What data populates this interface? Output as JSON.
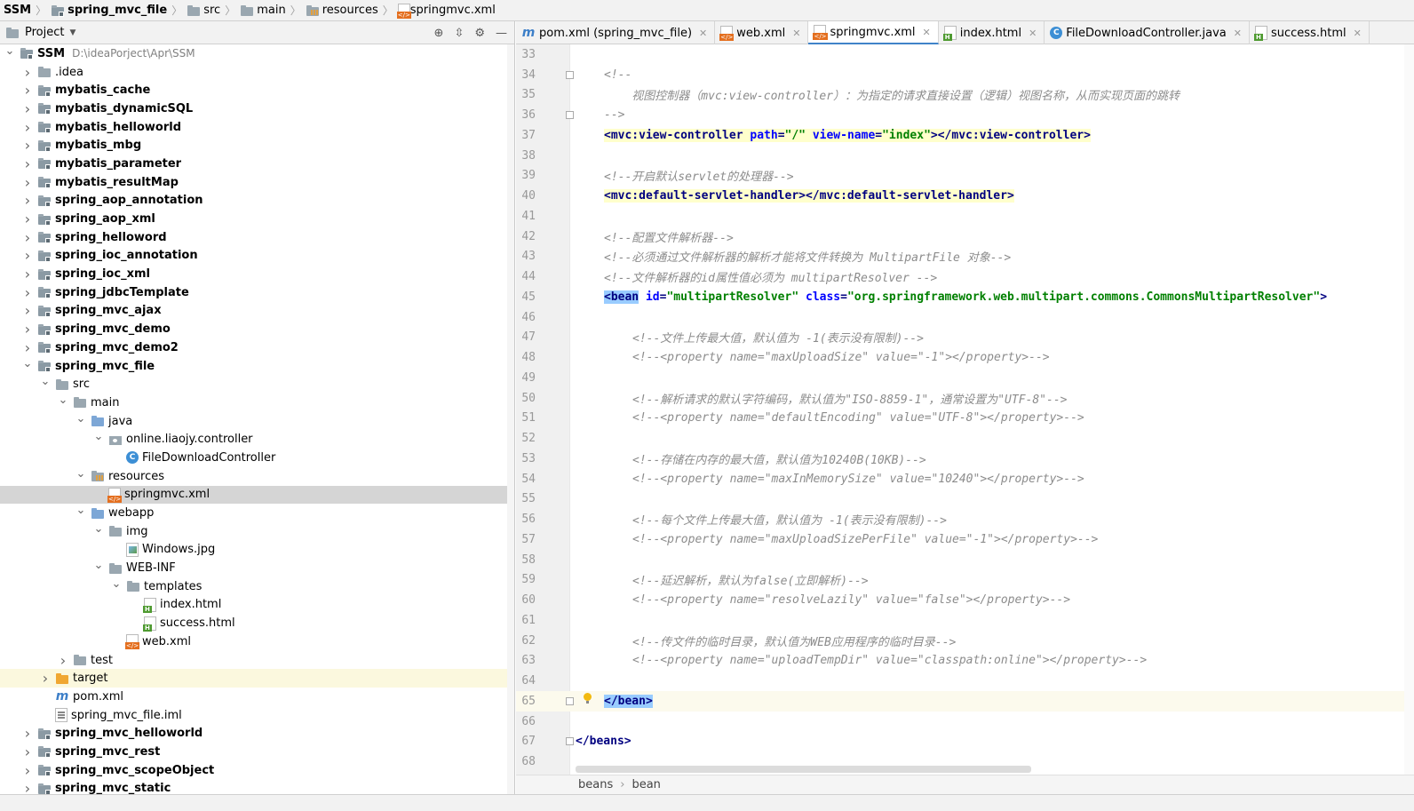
{
  "breadcrumbs": [
    "SSM",
    "spring_mvc_file",
    "src",
    "main",
    "resources",
    "springmvc.xml"
  ],
  "project_panel": {
    "title": "Project",
    "tree": [
      {
        "label": "SSM",
        "path": "D:\\ideaPorject\\Apr\\SSM",
        "depth": 0,
        "expanded": true,
        "icon": "module-folder-icon",
        "bold": true
      },
      {
        "label": ".idea",
        "depth": 1,
        "expanded": false,
        "icon": "folder-icon"
      },
      {
        "label": "mybatis_cache",
        "depth": 1,
        "expanded": false,
        "icon": "module-folder-icon",
        "bold": true
      },
      {
        "label": "mybatis_dynamicSQL",
        "depth": 1,
        "expanded": false,
        "icon": "module-folder-icon",
        "bold": true
      },
      {
        "label": "mybatis_helloworld",
        "depth": 1,
        "expanded": false,
        "icon": "module-folder-icon",
        "bold": true
      },
      {
        "label": "mybatis_mbg",
        "depth": 1,
        "expanded": false,
        "icon": "module-folder-icon",
        "bold": true
      },
      {
        "label": "mybatis_parameter",
        "depth": 1,
        "expanded": false,
        "icon": "module-folder-icon",
        "bold": true
      },
      {
        "label": "mybatis_resultMap",
        "depth": 1,
        "expanded": false,
        "icon": "module-folder-icon",
        "bold": true
      },
      {
        "label": "spring_aop_annotation",
        "depth": 1,
        "expanded": false,
        "icon": "module-folder-icon",
        "bold": true
      },
      {
        "label": "spring_aop_xml",
        "depth": 1,
        "expanded": false,
        "icon": "module-folder-icon",
        "bold": true
      },
      {
        "label": "spring_helloword",
        "depth": 1,
        "expanded": false,
        "icon": "module-folder-icon",
        "bold": true
      },
      {
        "label": "spring_ioc_annotation",
        "depth": 1,
        "expanded": false,
        "icon": "module-folder-icon",
        "bold": true
      },
      {
        "label": "spring_ioc_xml",
        "depth": 1,
        "expanded": false,
        "icon": "module-folder-icon",
        "bold": true
      },
      {
        "label": "spring_jdbcTemplate",
        "depth": 1,
        "expanded": false,
        "icon": "module-folder-icon",
        "bold": true
      },
      {
        "label": "spring_mvc_ajax",
        "depth": 1,
        "expanded": false,
        "icon": "module-folder-icon",
        "bold": true
      },
      {
        "label": "spring_mvc_demo",
        "depth": 1,
        "expanded": false,
        "icon": "module-folder-icon",
        "bold": true
      },
      {
        "label": "spring_mvc_demo2",
        "depth": 1,
        "expanded": false,
        "icon": "module-folder-icon",
        "bold": true
      },
      {
        "label": "spring_mvc_file",
        "depth": 1,
        "expanded": true,
        "icon": "module-folder-icon",
        "bold": true
      },
      {
        "label": "src",
        "depth": 2,
        "expanded": true,
        "icon": "folder-icon"
      },
      {
        "label": "main",
        "depth": 3,
        "expanded": true,
        "icon": "folder-icon"
      },
      {
        "label": "java",
        "depth": 4,
        "expanded": true,
        "icon": "source-folder-icon"
      },
      {
        "label": "online.liaojy.controller",
        "depth": 5,
        "expanded": true,
        "icon": "package-icon"
      },
      {
        "label": "FileDownloadController",
        "depth": 6,
        "leaf": true,
        "icon": "java-class-icon"
      },
      {
        "label": "resources",
        "depth": 4,
        "expanded": true,
        "icon": "resources-folder-icon"
      },
      {
        "label": "springmvc.xml",
        "depth": 5,
        "leaf": true,
        "icon": "xml-file-icon",
        "selected": true
      },
      {
        "label": "webapp",
        "depth": 4,
        "expanded": true,
        "icon": "web-folder-icon"
      },
      {
        "label": "img",
        "depth": 5,
        "expanded": true,
        "icon": "folder-icon"
      },
      {
        "label": "Windows.jpg",
        "depth": 6,
        "leaf": true,
        "icon": "image-file-icon"
      },
      {
        "label": "WEB-INF",
        "depth": 5,
        "expanded": true,
        "icon": "folder-icon"
      },
      {
        "label": "templates",
        "depth": 6,
        "expanded": true,
        "icon": "folder-icon"
      },
      {
        "label": "index.html",
        "depth": 7,
        "leaf": true,
        "icon": "html-file-icon"
      },
      {
        "label": "success.html",
        "depth": 7,
        "leaf": true,
        "icon": "html-file-icon"
      },
      {
        "label": "web.xml",
        "depth": 6,
        "leaf": true,
        "icon": "xml-file-icon"
      },
      {
        "label": "test",
        "depth": 3,
        "expanded": false,
        "icon": "folder-icon"
      },
      {
        "label": "target",
        "depth": 2,
        "expanded": false,
        "icon": "excluded-folder-icon",
        "highlighted": true
      },
      {
        "label": "pom.xml",
        "depth": 2,
        "leaf": true,
        "icon": "maven-file-icon"
      },
      {
        "label": "spring_mvc_file.iml",
        "depth": 2,
        "leaf": true,
        "icon": "iml-file-icon"
      },
      {
        "label": "spring_mvc_helloworld",
        "depth": 1,
        "expanded": false,
        "icon": "module-folder-icon",
        "bold": true
      },
      {
        "label": "spring_mvc_rest",
        "depth": 1,
        "expanded": false,
        "icon": "module-folder-icon",
        "bold": true
      },
      {
        "label": "spring_mvc_scopeObject",
        "depth": 1,
        "expanded": false,
        "icon": "module-folder-icon",
        "bold": true
      },
      {
        "label": "spring_mvc_static",
        "depth": 1,
        "expanded": false,
        "icon": "module-folder-icon",
        "bold": true
      }
    ]
  },
  "tabs": [
    {
      "label": "pom.xml (spring_mvc_file)",
      "icon": "maven-file-icon",
      "active": false
    },
    {
      "label": "web.xml",
      "icon": "xml-file-icon",
      "active": false
    },
    {
      "label": "springmvc.xml",
      "icon": "xml-file-icon",
      "active": true
    },
    {
      "label": "index.html",
      "icon": "html-file-icon",
      "active": false
    },
    {
      "label": "FileDownloadController.java",
      "icon": "java-class-icon",
      "active": false
    },
    {
      "label": "success.html",
      "icon": "html-file-icon",
      "active": false
    }
  ],
  "editor": {
    "current_line": 65,
    "lines": [
      {
        "n": "33",
        "indent": 0,
        "parts": []
      },
      {
        "n": "34",
        "indent": 1,
        "fold": true,
        "parts": [
          [
            "c",
            "<!--"
          ]
        ]
      },
      {
        "n": "35",
        "indent": 1,
        "parts": [
          [
            "c",
            "    视图控制器（mvc:view-controller）：为指定的请求直接设置（逻辑）视图名称，从而实现页面的跳转"
          ]
        ]
      },
      {
        "n": "36",
        "indent": 1,
        "fold": true,
        "parts": [
          [
            "c",
            "-->"
          ]
        ]
      },
      {
        "n": "37",
        "indent": 1,
        "hl": true,
        "parts": [
          [
            "tg",
            "<mvc:view-controller "
          ],
          [
            "at",
            "path"
          ],
          [
            "tg",
            "="
          ],
          [
            "sv",
            "\"/\""
          ],
          [
            "tg",
            " "
          ],
          [
            "at",
            "view-name"
          ],
          [
            "tg",
            "="
          ],
          [
            "sv",
            "\"index\""
          ],
          [
            "tg",
            "></mvc:view-controller>"
          ]
        ]
      },
      {
        "n": "38",
        "indent": 1,
        "parts": []
      },
      {
        "n": "39",
        "indent": 1,
        "parts": [
          [
            "c",
            "<!--开启默认servlet的处理器-->"
          ]
        ]
      },
      {
        "n": "40",
        "indent": 1,
        "hl": true,
        "parts": [
          [
            "tg",
            "<mvc:default-servlet-handler></mvc:default-servlet-handler>"
          ]
        ]
      },
      {
        "n": "41",
        "indent": 1,
        "parts": []
      },
      {
        "n": "42",
        "indent": 1,
        "parts": [
          [
            "c",
            "<!--配置文件解析器-->"
          ]
        ]
      },
      {
        "n": "43",
        "indent": 1,
        "parts": [
          [
            "c",
            "<!--必须通过文件解析器的解析才能将文件转换为 MultipartFile 对象-->"
          ]
        ]
      },
      {
        "n": "44",
        "indent": 1,
        "parts": [
          [
            "c",
            "<!--文件解析器的id属性值必须为 multipartResolver -->"
          ]
        ]
      },
      {
        "n": "45",
        "indent": 1,
        "parts": [
          [
            "bm",
            "<bean"
          ],
          [
            "tg",
            " "
          ],
          [
            "at",
            "id"
          ],
          [
            "tg",
            "="
          ],
          [
            "sv",
            "\"multipartResolver\""
          ],
          [
            "tg",
            " "
          ],
          [
            "at",
            "class"
          ],
          [
            "tg",
            "="
          ],
          [
            "sv",
            "\"org.springframework.web.multipart.commons.CommonsMultipartResolver\""
          ],
          [
            "tg",
            ">"
          ]
        ]
      },
      {
        "n": "46",
        "indent": 1,
        "parts": []
      },
      {
        "n": "47",
        "indent": 2,
        "parts": [
          [
            "c",
            "<!--文件上传最大值，默认值为 -1(表示没有限制)-->"
          ]
        ]
      },
      {
        "n": "48",
        "indent": 2,
        "parts": [
          [
            "c",
            "<!--<property name=\"maxUploadSize\" value=\"-1\"></property>-->"
          ]
        ]
      },
      {
        "n": "49",
        "indent": 2,
        "parts": []
      },
      {
        "n": "50",
        "indent": 2,
        "parts": [
          [
            "c",
            "<!--解析请求的默认字符编码，默认值为\"ISO-8859-1\"，通常设置为\"UTF-8\"-->"
          ]
        ]
      },
      {
        "n": "51",
        "indent": 2,
        "parts": [
          [
            "c",
            "<!--<property name=\"defaultEncoding\" value=\"UTF-8\"></property>-->"
          ]
        ]
      },
      {
        "n": "52",
        "indent": 2,
        "parts": []
      },
      {
        "n": "53",
        "indent": 2,
        "parts": [
          [
            "c",
            "<!--存储在内存的最大值，默认值为10240B(10KB)-->"
          ]
        ]
      },
      {
        "n": "54",
        "indent": 2,
        "parts": [
          [
            "c",
            "<!--<property name=\"maxInMemorySize\" value=\"10240\"></property>-->"
          ]
        ]
      },
      {
        "n": "55",
        "indent": 2,
        "parts": []
      },
      {
        "n": "56",
        "indent": 2,
        "parts": [
          [
            "c",
            "<!--每个文件上传最大值，默认值为 -1(表示没有限制)-->"
          ]
        ]
      },
      {
        "n": "57",
        "indent": 2,
        "parts": [
          [
            "c",
            "<!--<property name=\"maxUploadSizePerFile\" value=\"-1\"></property>-->"
          ]
        ]
      },
      {
        "n": "58",
        "indent": 2,
        "parts": []
      },
      {
        "n": "59",
        "indent": 2,
        "parts": [
          [
            "c",
            "<!--延迟解析，默认为false(立即解析)-->"
          ]
        ]
      },
      {
        "n": "60",
        "indent": 2,
        "parts": [
          [
            "c",
            "<!--<property name=\"resolveLazily\" value=\"false\"></property>-->"
          ]
        ]
      },
      {
        "n": "61",
        "indent": 2,
        "parts": []
      },
      {
        "n": "62",
        "indent": 2,
        "parts": [
          [
            "c",
            "<!--传文件的临时目录，默认值为WEB应用程序的临时目录-->"
          ]
        ]
      },
      {
        "n": "63",
        "indent": 2,
        "parts": [
          [
            "c",
            "<!--<property name=\"uploadTempDir\" value=\"classpath:online\"></property>-->"
          ]
        ]
      },
      {
        "n": "64",
        "indent": 1,
        "parts": []
      },
      {
        "n": "65",
        "indent": 1,
        "fold": true,
        "bulb": true,
        "parts": [
          [
            "bm",
            "</bean>"
          ]
        ]
      },
      {
        "n": "66",
        "indent": 0,
        "parts": []
      },
      {
        "n": "67",
        "indent": 0,
        "fold": true,
        "parts": [
          [
            "tg",
            "</beans>"
          ]
        ]
      },
      {
        "n": "68",
        "indent": 0,
        "parts": []
      }
    ]
  },
  "footer_breadcrumbs": [
    "beans",
    "bean"
  ]
}
